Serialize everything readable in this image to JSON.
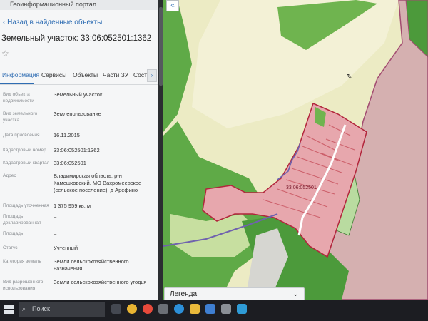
{
  "app": {
    "title": "Геоинформационный портал"
  },
  "nav": {
    "back_label": "Назад в найденные объекты"
  },
  "parcel": {
    "title": "Земельный участок: 33:06:052501:1362",
    "favorite_icon": "star-outline-icon"
  },
  "tabs": [
    {
      "label": "Информация",
      "active": true
    },
    {
      "label": "Сервисы",
      "active": false
    },
    {
      "label": "Объекты",
      "active": false
    },
    {
      "label": "Части ЗУ",
      "active": false
    },
    {
      "label": "Состав",
      "active": false
    }
  ],
  "tabs_more_icon": "chevron-right-icon",
  "tabs_more_glyph": "›",
  "attributes": [
    {
      "label": "Вид объекта недвижимости",
      "value": "Земельный участок"
    },
    {
      "label": "Вид земельного участка",
      "value": "Землепользование"
    },
    {
      "label": "Дата присвоения",
      "value": "16.11.2015"
    },
    {
      "label": "Кадастровый номер",
      "value": "33:06:052501:1362"
    },
    {
      "label": "Кадастровый квартал",
      "value": "33:06:052501"
    },
    {
      "label": "Адрес",
      "value": "Владимирская область, р-н Камешковский, МО Вахромеевское (сельское поселение), д Арефино"
    },
    {
      "label": "Площадь уточненная",
      "value": "1 375 959 кв. м"
    },
    {
      "label": "Площадь декларированная",
      "value": "–"
    },
    {
      "label": "Площадь",
      "value": "–"
    },
    {
      "label": "Статус",
      "value": "Учтенный"
    },
    {
      "label": "Категория земель",
      "value": "Земли сельскохозяйственного назначения"
    },
    {
      "label": "Вид разрешенного использования",
      "value": "Земли сельскохозяйственного угодья"
    }
  ],
  "map": {
    "collapse_icon": "double-chevron-left-icon",
    "collapse_glyph": "«",
    "cadastral_label": "33:06:052501",
    "legend_label": "Легенда",
    "legend_icon": "chevron-down-icon",
    "legend_glyph": "⌄",
    "cursor_icon": "mouse-pointer-icon",
    "colors": {
      "field": "#ecebc4",
      "field_light": "#f3f1d6",
      "forest": "#5faa47",
      "forest_dark": "#4c9a3b",
      "meadow": "#c7dfa0",
      "parcel_fill": "#e7a7ad",
      "parcel_border": "#b2253b",
      "zone_mauve": "#d5b0b0",
      "zone_border": "#a24b70",
      "road": "#6f62ae"
    }
  },
  "taskbar": {
    "search_placeholder": "Поиск",
    "search_icon": "search-icon",
    "start_icon": "windows-start-icon",
    "apps": [
      {
        "name": "chrome-icon",
        "color": "#e8b432"
      },
      {
        "name": "yandex-browser-icon",
        "color": "#e84a3b"
      },
      {
        "name": "task-view-icon",
        "color": "#6b6f76"
      },
      {
        "name": "edge-icon",
        "color": "#2c8fd8"
      },
      {
        "name": "file-explorer-icon",
        "color": "#e9b93b"
      },
      {
        "name": "mail-icon",
        "color": "#3f7fd2"
      },
      {
        "name": "store-icon",
        "color": "#8a8f96"
      },
      {
        "name": "photos-icon",
        "color": "#2f9bd6"
      },
      {
        "name": "app-icon",
        "color": "#444851"
      }
    ]
  }
}
